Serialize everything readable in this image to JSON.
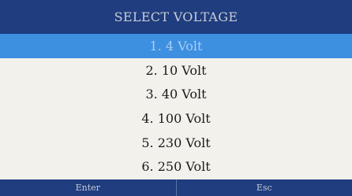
{
  "header": {
    "title": "SELECT VOLTAGE"
  },
  "voltage_options": [
    {
      "label": "1. 4 Volt",
      "selected": true
    },
    {
      "label": "2. 10 Volt",
      "selected": false
    },
    {
      "label": "3. 40 Volt",
      "selected": false
    },
    {
      "label": "4. 100 Volt",
      "selected": false
    },
    {
      "label": "5. 230 Volt",
      "selected": false
    },
    {
      "label": "6. 250 Volt",
      "selected": false
    }
  ],
  "footer": {
    "enter_label": "Enter",
    "esc_label": "Esc"
  },
  "colors": {
    "header_bg": "#1f3d7f",
    "selection_bg": "#3d8fe0",
    "list_bg": "#f3f1ec"
  }
}
